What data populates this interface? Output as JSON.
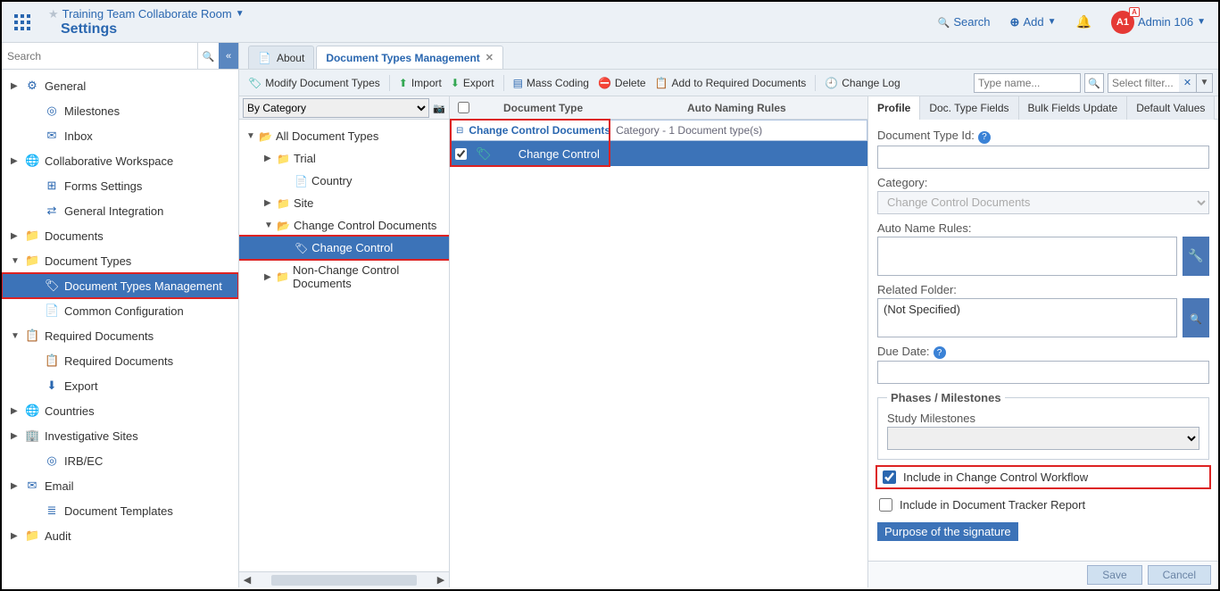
{
  "header": {
    "room_name": "Training Team Collaborate Room",
    "page_title": "Settings",
    "search_label": "Search",
    "add_label": "Add",
    "user_code": "A1",
    "user_badge": "A",
    "user_name": "Admin 106"
  },
  "sidebar": {
    "search_placeholder": "Search",
    "items": [
      {
        "label": "General",
        "icon": "⚙",
        "exp": true,
        "depth": 0
      },
      {
        "label": "Milestones",
        "icon": "◎",
        "depth": 1
      },
      {
        "label": "Inbox",
        "icon": "✉",
        "depth": 1
      },
      {
        "label": "Collaborative Workspace",
        "icon": "🌐",
        "exp": true,
        "depth": 0
      },
      {
        "label": "Forms Settings",
        "icon": "⊞",
        "depth": 1
      },
      {
        "label": "General Integration",
        "icon": "⇄",
        "depth": 1
      },
      {
        "label": "Documents",
        "icon": "📁",
        "exp": true,
        "depth": 0
      },
      {
        "label": "Document Types",
        "icon": "📁",
        "exp": true,
        "open": true,
        "depth": 0
      },
      {
        "label": "Document Types Management",
        "icon": "🏷",
        "depth": 1,
        "selected": true,
        "boxed": true
      },
      {
        "label": "Common Configuration",
        "icon": "📄",
        "depth": 1
      },
      {
        "label": "Required Documents",
        "icon": "📋",
        "exp": true,
        "open": true,
        "depth": 0
      },
      {
        "label": "Required Documents",
        "icon": "📋",
        "depth": 1
      },
      {
        "label": "Export",
        "icon": "⬇",
        "depth": 1
      },
      {
        "label": "Countries",
        "icon": "🌐",
        "exp": true,
        "depth": 0
      },
      {
        "label": "Investigative Sites",
        "icon": "🏢",
        "exp": true,
        "depth": 0
      },
      {
        "label": "IRB/EC",
        "icon": "◎",
        "depth": 1
      },
      {
        "label": "Email",
        "icon": "✉",
        "exp": true,
        "depth": 0
      },
      {
        "label": "Document Templates",
        "icon": "≣",
        "depth": 1
      },
      {
        "label": "Audit",
        "icon": "📁",
        "exp": true,
        "depth": 0
      }
    ]
  },
  "tabs": [
    {
      "label": "About",
      "icon": "📄",
      "active": false
    },
    {
      "label": "Document Types Management",
      "icon": "",
      "active": true,
      "closable": true
    }
  ],
  "toolbar": {
    "modify": "Modify Document Types",
    "import": "Import",
    "export": "Export",
    "mass_coding": "Mass Coding",
    "delete": "Delete",
    "add_req": "Add to Required Documents",
    "change_log": "Change Log",
    "type_name_placeholder": "Type name...",
    "filter_placeholder": "Select filter..."
  },
  "tree": {
    "view_mode": "By Category",
    "root": "All Document Types",
    "nodes": [
      {
        "label": "Trial",
        "depth": 1,
        "exp": true,
        "icon": "📁"
      },
      {
        "label": "Country",
        "depth": 2,
        "icon": "📄"
      },
      {
        "label": "Site",
        "depth": 1,
        "exp": true,
        "icon": "📁"
      },
      {
        "label": "Change Control Documents",
        "depth": 1,
        "exp": true,
        "open": true,
        "icon": "📂"
      },
      {
        "label": "Change Control",
        "depth": 2,
        "icon": "🏷",
        "selected": true,
        "boxed": true
      },
      {
        "label": "Non-Change Control Documents",
        "depth": 1,
        "exp": true,
        "icon": "📁"
      }
    ]
  },
  "grid": {
    "columns": {
      "type": "Document Type",
      "rules": "Auto Naming Rules"
    },
    "group": {
      "category": "Change Control Documents",
      "suffix": "Category - 1 Document type(s)"
    },
    "row": {
      "name": "Change Control",
      "checked": true
    }
  },
  "detail": {
    "tabs": [
      "Profile",
      "Doc. Type Fields",
      "Bulk Fields Update",
      "Default Values"
    ],
    "active_tab": 0,
    "doc_type_id_label": "Document Type Id:",
    "doc_type_id": "",
    "category_label": "Category:",
    "category": "Change Control Documents",
    "auto_rules_label": "Auto Name Rules:",
    "auto_rules": "",
    "related_folder_label": "Related Folder:",
    "related_folder": "(Not Specified)",
    "due_date_label": "Due Date:",
    "due_date": "",
    "phases_legend": "Phases / Milestones",
    "study_milestones_label": "Study Milestones",
    "chk_change_control": "Include in Change Control Workflow",
    "chk_change_control_checked": true,
    "chk_tracker": "Include in Document Tracker Report",
    "chk_tracker_checked": false,
    "purpose": "Purpose of the signature",
    "save": "Save",
    "cancel": "Cancel"
  }
}
